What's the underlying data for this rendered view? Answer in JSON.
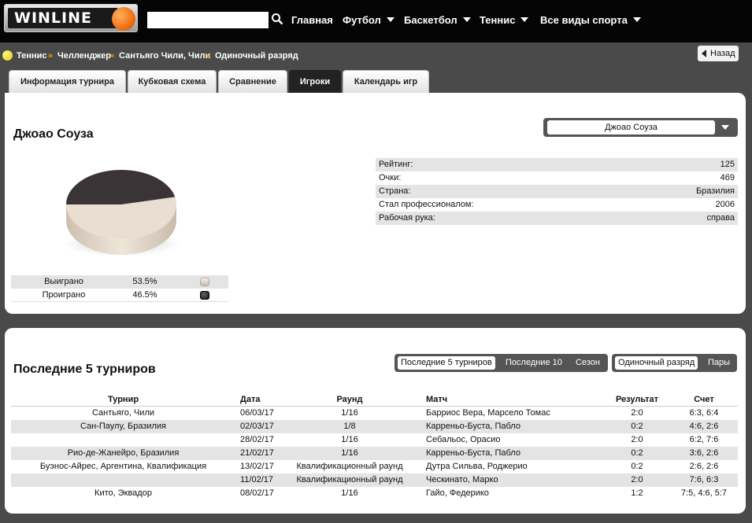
{
  "header": {
    "logo_text": "WINLINE",
    "search": {
      "value": "",
      "placeholder": ""
    },
    "nav": [
      {
        "label": "Главная",
        "dropdown": false
      },
      {
        "label": "Футбол",
        "dropdown": true
      },
      {
        "label": "Баскетбол",
        "dropdown": true
      },
      {
        "label": "Теннис",
        "dropdown": true
      },
      {
        "label": "Все виды спорта",
        "dropdown": true
      }
    ]
  },
  "breadcrumb": {
    "items": [
      "Теннис",
      "Челленджер",
      "Сантьяго Чили, Чили",
      "Одиночный разряд"
    ],
    "separator": "»",
    "back_label": "Назад"
  },
  "tabs": [
    {
      "label": "Информация турнира",
      "active": false
    },
    {
      "label": "Кубковая схема",
      "active": false
    },
    {
      "label": "Сравнение",
      "active": false
    },
    {
      "label": "Игроки",
      "active": true
    },
    {
      "label": "Календарь игр",
      "active": false
    }
  ],
  "player": {
    "name": "Джоао Соуза",
    "select_value": "Джоао Соуза",
    "stats": [
      {
        "label": "Рейтинг:",
        "value": "125"
      },
      {
        "label": "Очки:",
        "value": "469"
      },
      {
        "label": "Страна:",
        "value": "Бразилия"
      },
      {
        "label": "Стал профессионалом:",
        "value": "2006"
      },
      {
        "label": "Рабочая рука:",
        "value": "справа"
      }
    ],
    "win_loss": [
      {
        "label": "Выиграно",
        "percent": "53.5%",
        "fraction": 0.535,
        "color": "#e8dfd2"
      },
      {
        "label": "Проиграно",
        "percent": "46.5%",
        "fraction": 0.465,
        "color": "#3a3436"
      }
    ]
  },
  "recent": {
    "title": "Последние 5 турниров",
    "period_filter": [
      {
        "label": "Последние 5 турниров",
        "selected": true
      },
      {
        "label": "Последние 10",
        "selected": false
      },
      {
        "label": "Сезон",
        "selected": false
      }
    ],
    "type_filter": [
      {
        "label": "Одиночный разряд",
        "selected": true
      },
      {
        "label": "Пары",
        "selected": false
      }
    ],
    "columns": [
      "Турнир",
      "Дата",
      "Раунд",
      "Матч",
      "Результат",
      "Счет"
    ],
    "rows": [
      [
        "Сантьяго, Чили",
        "06/03/17",
        "1/16",
        "Барриос Вера, Марсело Томас",
        "2:0",
        "6:3, 6:4"
      ],
      [
        "Сан-Паулу, Бразилия",
        "02/03/17",
        "1/8",
        "Карреньо-Буста, Пабло",
        "0:2",
        "4:6, 2:6"
      ],
      [
        "",
        "28/02/17",
        "1/16",
        "Себальос, Орасио",
        "2:0",
        "6:2, 7:6"
      ],
      [
        "Рио-де-Жанейро, Бразилия",
        "21/02/17",
        "1/16",
        "Карреньо-Буста, Пабло",
        "0:2",
        "3:6, 2:6"
      ],
      [
        "Буэнос-Айрес, Аргентина, Квалификация",
        "13/02/17",
        "Квалификационный раунд",
        "Дутра Сильва, Роджерио",
        "0:2",
        "2:6, 2:6"
      ],
      [
        "",
        "11/02/17",
        "Квалификационный раунд",
        "Ческинато, Марко",
        "2:0",
        "7:6, 6:3"
      ],
      [
        "Кито, Эквадор",
        "08/02/17",
        "1/16",
        "Гайо, Федерико",
        "1:2",
        "7:5, 4:6, 5:7"
      ]
    ]
  }
}
